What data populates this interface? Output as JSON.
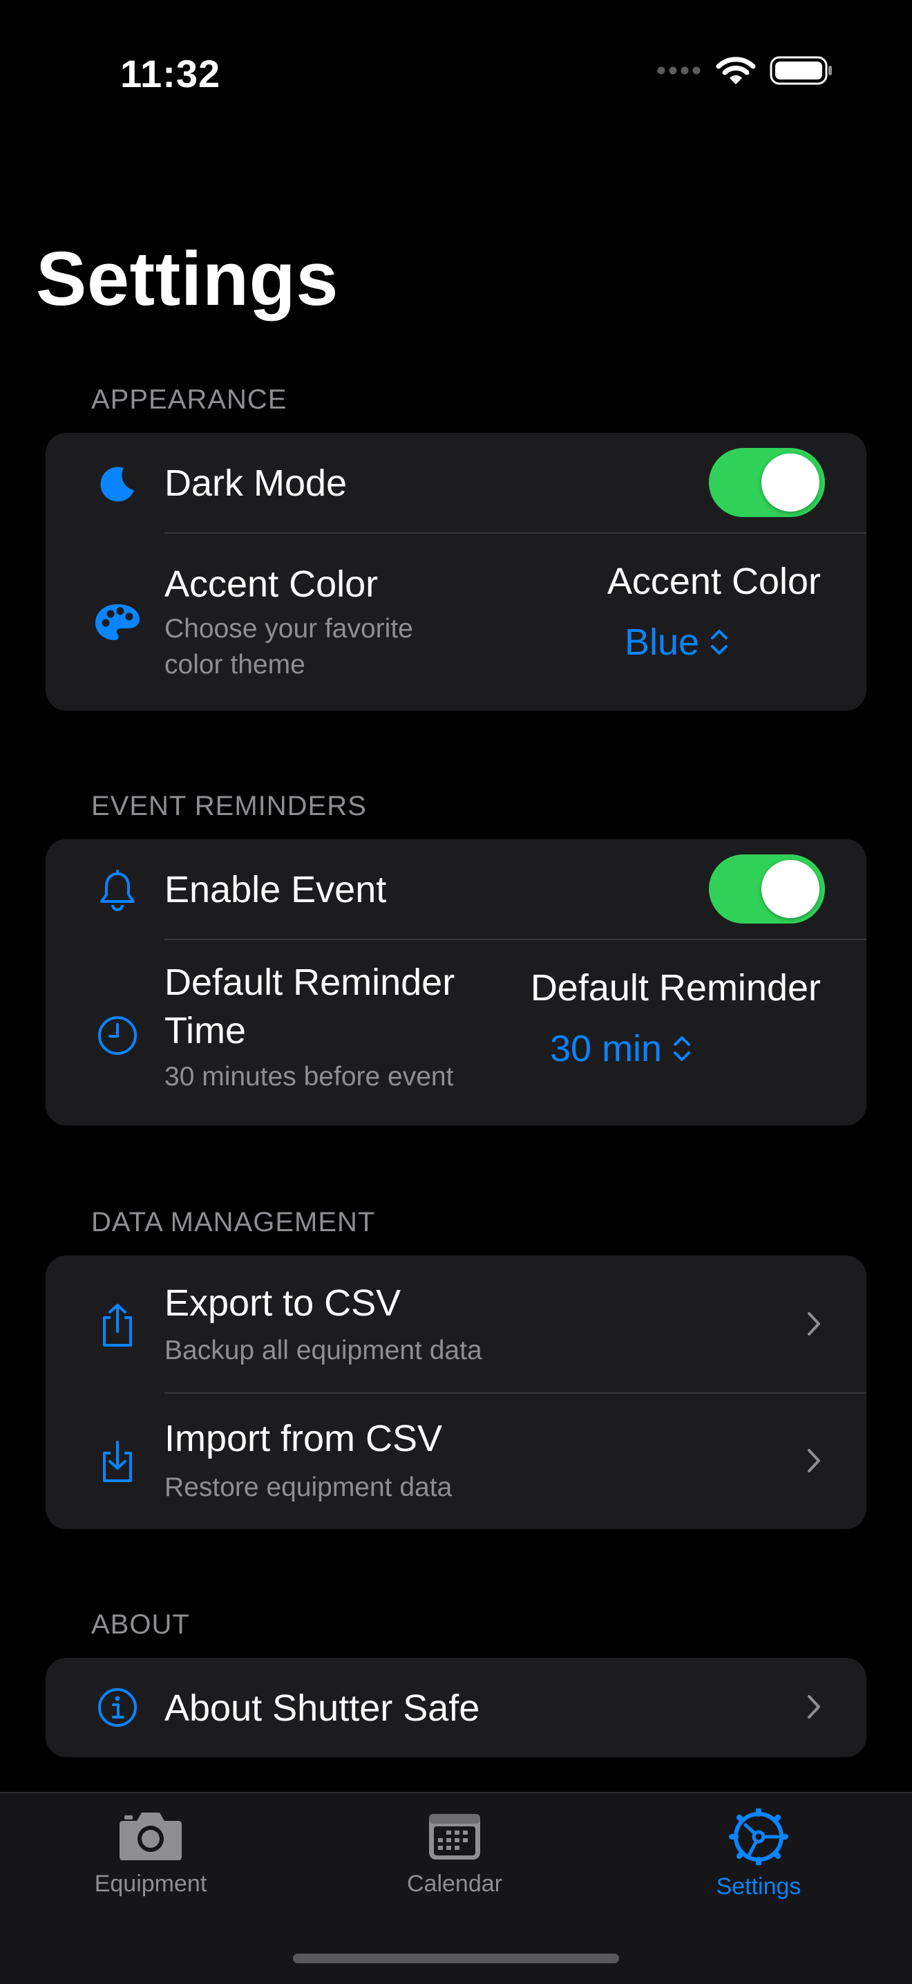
{
  "status_bar": {
    "time": "11:32"
  },
  "title": "Settings",
  "sections": {
    "appearance": {
      "header": "APPEARANCE",
      "dark_mode": {
        "label": "Dark Mode",
        "enabled": true,
        "icon": "moon-icon"
      },
      "accent_color": {
        "label": "Accent Color",
        "subtitle_line1": "Choose your favorite",
        "subtitle_line2": "color theme",
        "picker_label": "Accent Color",
        "picker_value": "Blue",
        "icon": "palette-icon"
      }
    },
    "event_reminders": {
      "header": "EVENT REMINDERS",
      "enable_event": {
        "label": "Enable Event",
        "enabled": true,
        "icon": "bell-icon"
      },
      "default_reminder": {
        "label_line1": "Default Reminder",
        "label_line2": "Time",
        "subtitle": "30 minutes before event",
        "picker_label": "Default Reminder",
        "picker_value": "30 min",
        "icon": "clock-icon"
      }
    },
    "data_management": {
      "header": "DATA MANAGEMENT",
      "export": {
        "label": "Export to CSV",
        "subtitle": "Backup all equipment data",
        "icon": "share-icon"
      },
      "import": {
        "label": "Import from CSV",
        "subtitle": "Restore equipment data",
        "icon": "download-icon"
      }
    },
    "about": {
      "header": "ABOUT",
      "about_app": {
        "label": "About Shutter Safe",
        "icon": "info-icon"
      }
    }
  },
  "tab_bar": {
    "tabs": [
      {
        "label": "Equipment",
        "icon": "camera-icon",
        "active": false
      },
      {
        "label": "Calendar",
        "icon": "calendar-icon",
        "active": false
      },
      {
        "label": "Settings",
        "icon": "settings-icon",
        "active": true
      }
    ]
  },
  "colors": {
    "accent": "#0a84ff",
    "toggle_on": "#30d158",
    "card_bg": "#1c1c1e",
    "secondary_text": "#8e8e93"
  }
}
